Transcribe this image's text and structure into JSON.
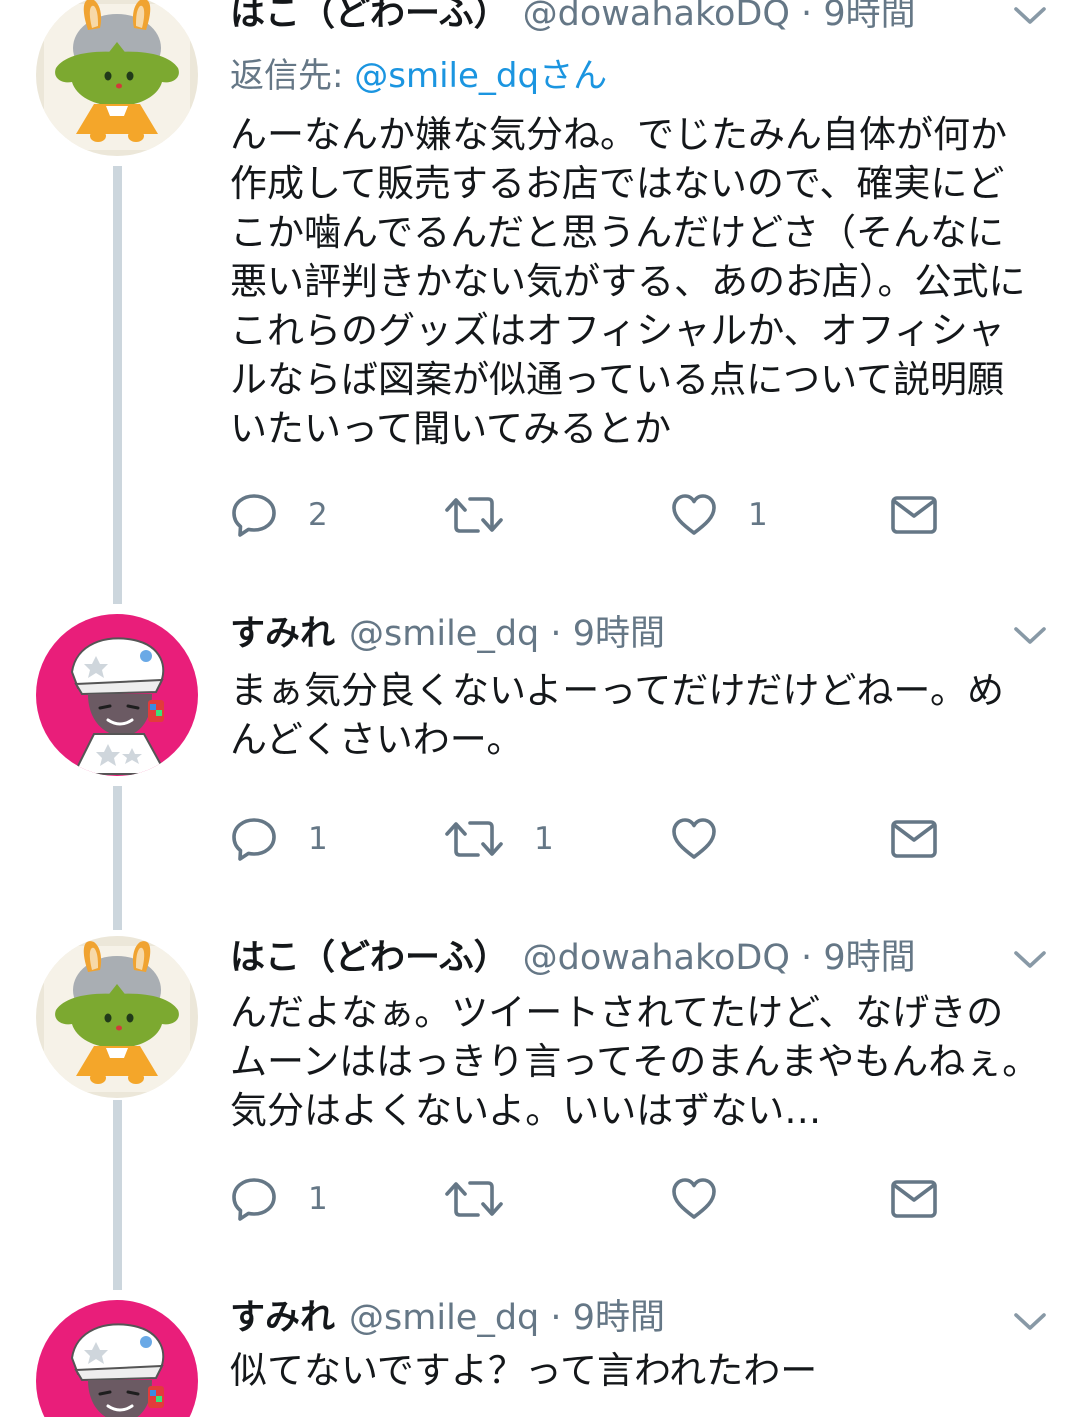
{
  "tweets": [
    {
      "name": "はこ（どわーふ）",
      "handle": "@dowahakoDQ",
      "dot": "·",
      "time": "9時間",
      "reply_label": "返信先: ",
      "reply_mention": "@smile_dqさん",
      "text": "んーなんか嫌な気分ね。でじたみん自体が何か作成して販売するお店ではないので、確実にどこか噛んでるんだと思うんだけどさ（そんなに悪い評判きかない気がする、あのお店）。公式にこれらのグッズはオフィシャルか、オフィシャルならば図案が似通っている点について説明願いたいって聞いてみるとか",
      "reply_count": "2",
      "retweet_count": "",
      "like_count": "1",
      "avatar": "green-creature-avatar"
    },
    {
      "name": "すみれ",
      "handle": "@smile_dq",
      "dot": "·",
      "time": "9時間",
      "text": "まぁ気分良くないよーってだけだけどねー。めんどくさいわー。",
      "reply_count": "1",
      "retweet_count": "1",
      "like_count": "",
      "avatar": "pink-girl-avatar"
    },
    {
      "name": "はこ（どわーふ）",
      "handle": "@dowahakoDQ",
      "dot": "·",
      "time": "9時間",
      "text": "んだよなぁ。ツイートされてたけど、なげきのムーンははっきり言ってそのまんまやもんねぇ。気分はよくないよ。いいはずない…",
      "reply_count": "1",
      "retweet_count": "",
      "like_count": "",
      "avatar": "green-creature-avatar"
    },
    {
      "name": "すみれ",
      "handle": "@smile_dq",
      "dot": "·",
      "time": "9時間",
      "text": "似てないですよ？って言われたわー",
      "avatar": "pink-girl-avatar"
    }
  ],
  "colors": {
    "text": "#14171a",
    "secondary": "#657786",
    "link": "#1b95e0",
    "thread_line": "#ccd6dd",
    "pink_avatar_bg": "#e91e7a"
  },
  "icons": [
    "reply-icon",
    "retweet-icon",
    "like-icon",
    "dm-icon",
    "chevron-down-icon"
  ]
}
